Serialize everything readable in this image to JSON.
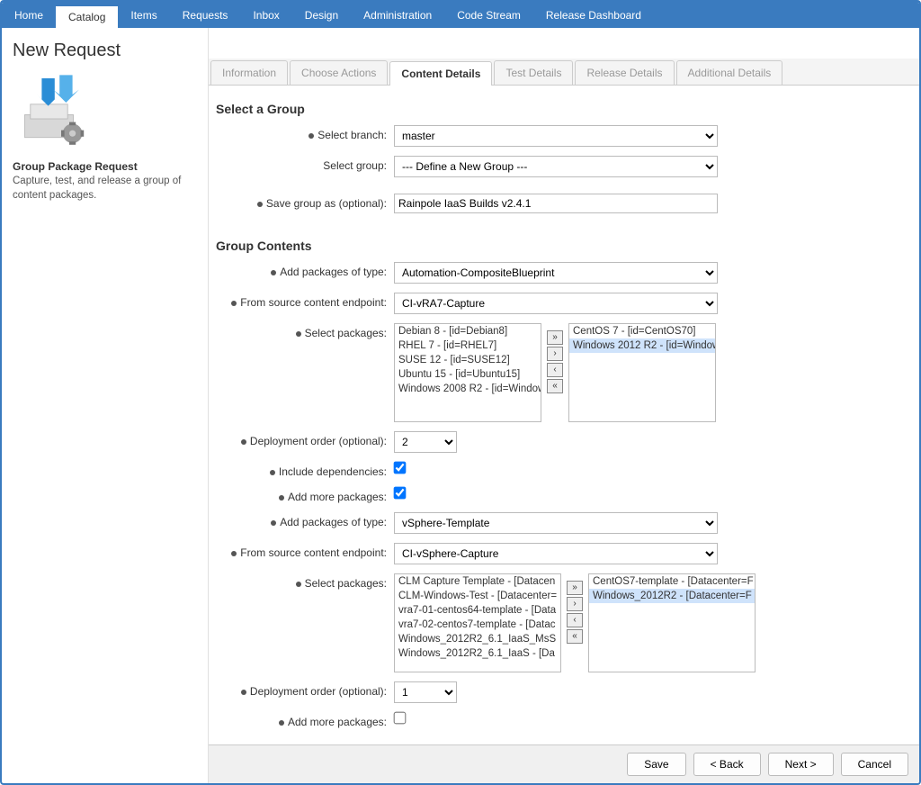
{
  "topnav": {
    "items": [
      "Home",
      "Catalog",
      "Items",
      "Requests",
      "Inbox",
      "Design",
      "Administration",
      "Code Stream",
      "Release Dashboard"
    ],
    "activeIndex": 1
  },
  "sidebar": {
    "pageTitle": "New Request",
    "title": "Group Package Request",
    "desc": "Capture, test, and release a group of content packages."
  },
  "tabs": {
    "items": [
      "Information",
      "Choose Actions",
      "Content Details",
      "Test Details",
      "Release Details",
      "Additional Details"
    ],
    "activeIndex": 2
  },
  "section1": {
    "heading": "Select a Group"
  },
  "labels": {
    "selectBranch": "Select branch:",
    "selectGroup": "Select group:",
    "saveGroupAs": "Save group as (optional):",
    "addPackagesOfType": "Add packages of type:",
    "fromSource": "From source content endpoint:",
    "selectPackages": "Select packages:",
    "deployOrder": "Deployment order (optional):",
    "includeDeps": "Include dependencies:",
    "addMore": "Add more packages:"
  },
  "values": {
    "branch": "master",
    "group": "--- Define a New Group ---",
    "saveAs": "Rainpole IaaS Builds v2.4.1"
  },
  "section2": {
    "heading": "Group Contents"
  },
  "pkg1": {
    "type": "Automation-CompositeBlueprint",
    "source": "CI-vRA7-Capture",
    "available": [
      "Debian 8 - [id=Debian8]",
      "RHEL 7 - [id=RHEL7]",
      "SUSE 12 - [id=SUSE12]",
      "Ubuntu 15 - [id=Ubuntu15]",
      "Windows 2008 R2 - [id=Window"
    ],
    "selected": [
      "CentOS 7 - [id=CentOS70]",
      "Windows 2012 R2 - [id=Window"
    ],
    "deployOrder": "2",
    "includeDeps": true,
    "addMore": true
  },
  "pkg2": {
    "type": "vSphere-Template",
    "source": "CI-vSphere-Capture",
    "available": [
      "CLM Capture Template - [Datacen",
      "CLM-Windows-Test - [Datacenter=",
      "vra7-01-centos64-template - [Data",
      "vra7-02-centos7-template - [Datac",
      "Windows_2012R2_6.1_IaaS_MsS",
      "Windows_2012R2_6.1_IaaS - [Da"
    ],
    "selected": [
      "CentOS7-template - [Datacenter=F",
      "Windows_2012R2 - [Datacenter=F"
    ],
    "deployOrder": "1",
    "addMore": false
  },
  "footer": {
    "save": "Save",
    "back": "< Back",
    "next": "Next >",
    "cancel": "Cancel"
  }
}
